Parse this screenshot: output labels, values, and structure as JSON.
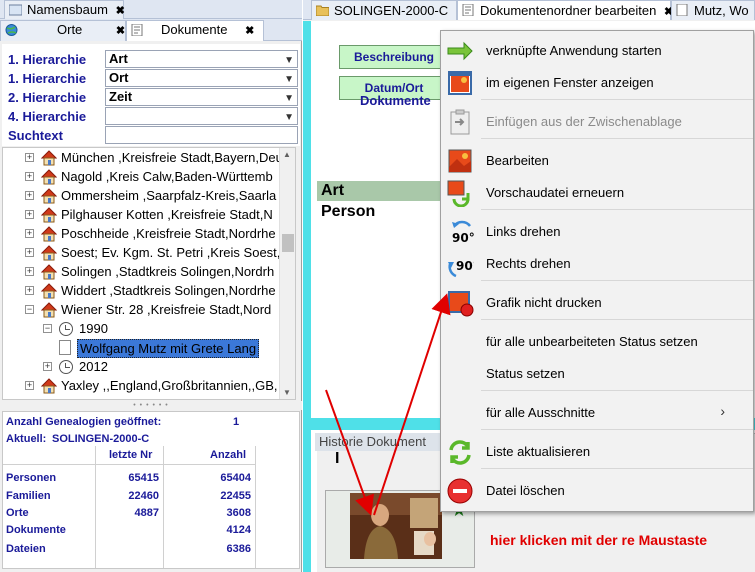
{
  "left_tabs_top": {
    "namensbaum": "Namensbaum",
    "close": "✖"
  },
  "left_tabs": {
    "orte": "Orte",
    "dokumente": "Dokumente",
    "close": "✖"
  },
  "hierarchy": [
    {
      "label": "1. Hierarchie",
      "value": "Art"
    },
    {
      "label": "1. Hierarchie",
      "value": "Ort"
    },
    {
      "label": "2. Hierarchie",
      "value": "Zeit"
    },
    {
      "label": "4. Hierarchie",
      "value": ""
    }
  ],
  "search": {
    "label": "Suchtext",
    "value": ""
  },
  "tree": [
    {
      "label": "München ,Kreisfreie Stadt,Bayern,Deu",
      "kind": "place"
    },
    {
      "label": "Nagold ,Kreis Calw,Baden-Württemb",
      "kind": "place"
    },
    {
      "label": "Ommersheim ,Saarpfalz-Kreis,Saarla",
      "kind": "place"
    },
    {
      "label": "Pilghauser Kotten ,Kreisfreie Stadt,N",
      "kind": "place"
    },
    {
      "label": "Poschheide ,Kreisfreie Stadt,Nordrhe",
      "kind": "place"
    },
    {
      "label": "Soest; Ev. Kgm. St. Petri ,Kreis Soest,",
      "kind": "place"
    },
    {
      "label": "Solingen ,Stadtkreis Solingen,Nordrh",
      "kind": "place"
    },
    {
      "label": "Widdert ,Stadtkreis Solingen,Nordrhe",
      "kind": "place"
    },
    {
      "label": "Wiener Str. 28 ,Kreisfreie Stadt,Nord",
      "kind": "place"
    },
    {
      "label": "1990",
      "kind": "year"
    },
    {
      "label": "Wolfgang Mutz mit Grete Lang",
      "kind": "doc"
    },
    {
      "label": "2012",
      "kind": "year"
    },
    {
      "label": "Yaxley ,,England,Großbritannien,,GB,",
      "kind": "place"
    }
  ],
  "stats": {
    "opened_label": "Anzahl Genealogien geöffnet:",
    "opened_value": "1",
    "current_label": "Aktuell:",
    "current_value": "SOLINGEN-2000-C",
    "col_last": "letzte Nr",
    "col_count": "Anzahl",
    "rows": [
      {
        "label": "Personen",
        "last": "65415",
        "count": "65404"
      },
      {
        "label": "Familien",
        "last": "22460",
        "count": "22455"
      },
      {
        "label": "Orte",
        "last": "4887",
        "count": "3608"
      },
      {
        "label": "Dokumente",
        "last": "",
        "count": "4124"
      },
      {
        "label": "Dateien",
        "last": "",
        "count": "6386"
      }
    ]
  },
  "right_tabs": {
    "tab1": "SOLINGEN-2000-C",
    "tab2": "Dokumentenordner bearbeiten",
    "tab3": "Mutz, Wo",
    "close": "✖"
  },
  "right_panel": {
    "beschreibung": "Beschreibung",
    "datum_ort": "Datum/Ort",
    "dokumente": "Dokumente",
    "grid_header": "Art",
    "grid_cell": "Person",
    "history_label": "Historie Dokument",
    "history_cursor": "I",
    "hint": "hier klicken mit der re Maustaste",
    "partial_right_label": "r"
  },
  "context_menu": [
    {
      "label": "verknüpfte Anwendung starten",
      "icon": "green-arrow-icon",
      "disabled": false
    },
    {
      "label": "im eigenen Fenster anzeigen",
      "icon": "window-image-icon",
      "disabled": false
    },
    {
      "label": "Einfügen aus der Zwischenablage",
      "icon": "clipboard-paste-icon",
      "disabled": true
    },
    {
      "label": "Bearbeiten",
      "icon": "image-edit-icon",
      "disabled": false
    },
    {
      "label": "Vorschaudatei erneuern",
      "icon": "refresh-preview-icon",
      "disabled": false
    },
    {
      "label": "Links drehen",
      "icon": "rotate-left-icon",
      "disabled": false
    },
    {
      "label": "Rechts drehen",
      "icon": "rotate-right-icon",
      "disabled": false
    },
    {
      "label": "Grafik nicht drucken",
      "icon": "no-print-icon",
      "disabled": false
    },
    {
      "label": "für alle unbearbeiteten Status setzen",
      "icon": "",
      "disabled": false
    },
    {
      "label": "Status setzen",
      "icon": "",
      "disabled": false
    },
    {
      "label": "für alle Ausschnitte",
      "icon": "",
      "disabled": false,
      "submenu": "›"
    },
    {
      "label": "Liste aktualisieren",
      "icon": "refresh-list-icon",
      "disabled": false
    },
    {
      "label": "Datei löschen",
      "icon": "delete-file-icon",
      "disabled": false
    }
  ],
  "rotate_badge": "90°",
  "colors": {
    "accent_cyan": "#4fe0e8",
    "label_blue": "#1a1a99",
    "button_green": "#c8f6c8",
    "hint_red": "#e00000",
    "selection": "#3b78d8"
  }
}
